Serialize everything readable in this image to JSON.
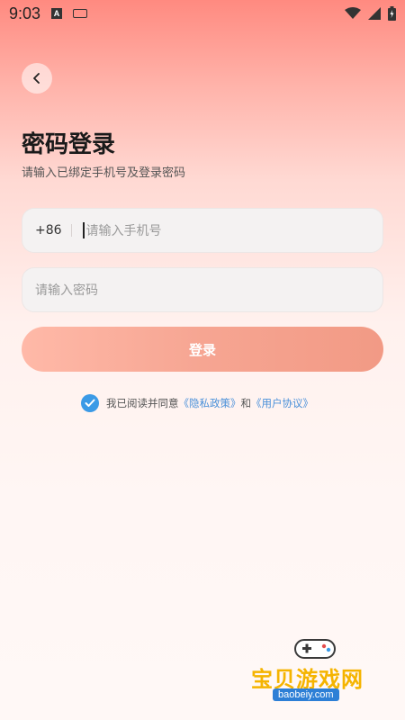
{
  "status_bar": {
    "time": "9:03",
    "icons": [
      "a-icon",
      "keyboard-icon",
      "wifi-icon",
      "signal-icon",
      "battery-icon"
    ]
  },
  "header": {
    "back_icon": "chevron-left-icon"
  },
  "page": {
    "title": "密码登录",
    "subtitle": "请输入已绑定手机号及登录密码"
  },
  "form": {
    "country_code": "+86",
    "phone_placeholder": "请输入手机号",
    "password_placeholder": "请输入密码",
    "login_label": "登录"
  },
  "agreement": {
    "prefix": "我已阅读并同意",
    "privacy_link": "《隐私政策》",
    "connector": "和",
    "user_link": "《用户协议》",
    "checked": true
  },
  "watermark": {
    "brand": "宝贝游戏网",
    "url": "baobeiy.com"
  },
  "colors": {
    "accent": "#f29a85",
    "link": "#4a90d9",
    "check": "#3b9ae6"
  }
}
